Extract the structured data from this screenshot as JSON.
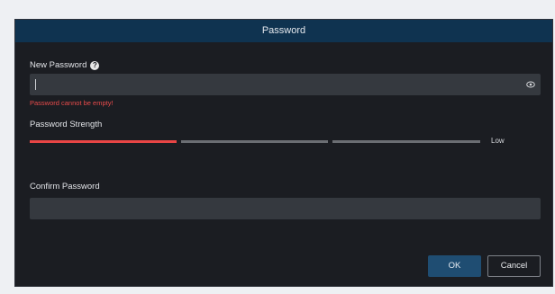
{
  "dialog": {
    "title": "Password",
    "new_password": {
      "label": "New Password",
      "value": "",
      "error": "Password cannot be empty!"
    },
    "strength": {
      "label": "Password Strength",
      "level_text": "Low",
      "level_fraction": 0.333,
      "colors": {
        "active": "#e84545",
        "inactive": "#6b6e73"
      }
    },
    "confirm_password": {
      "label": "Confirm Password",
      "value": ""
    },
    "buttons": {
      "ok_label": "OK",
      "cancel_label": "Cancel"
    }
  }
}
